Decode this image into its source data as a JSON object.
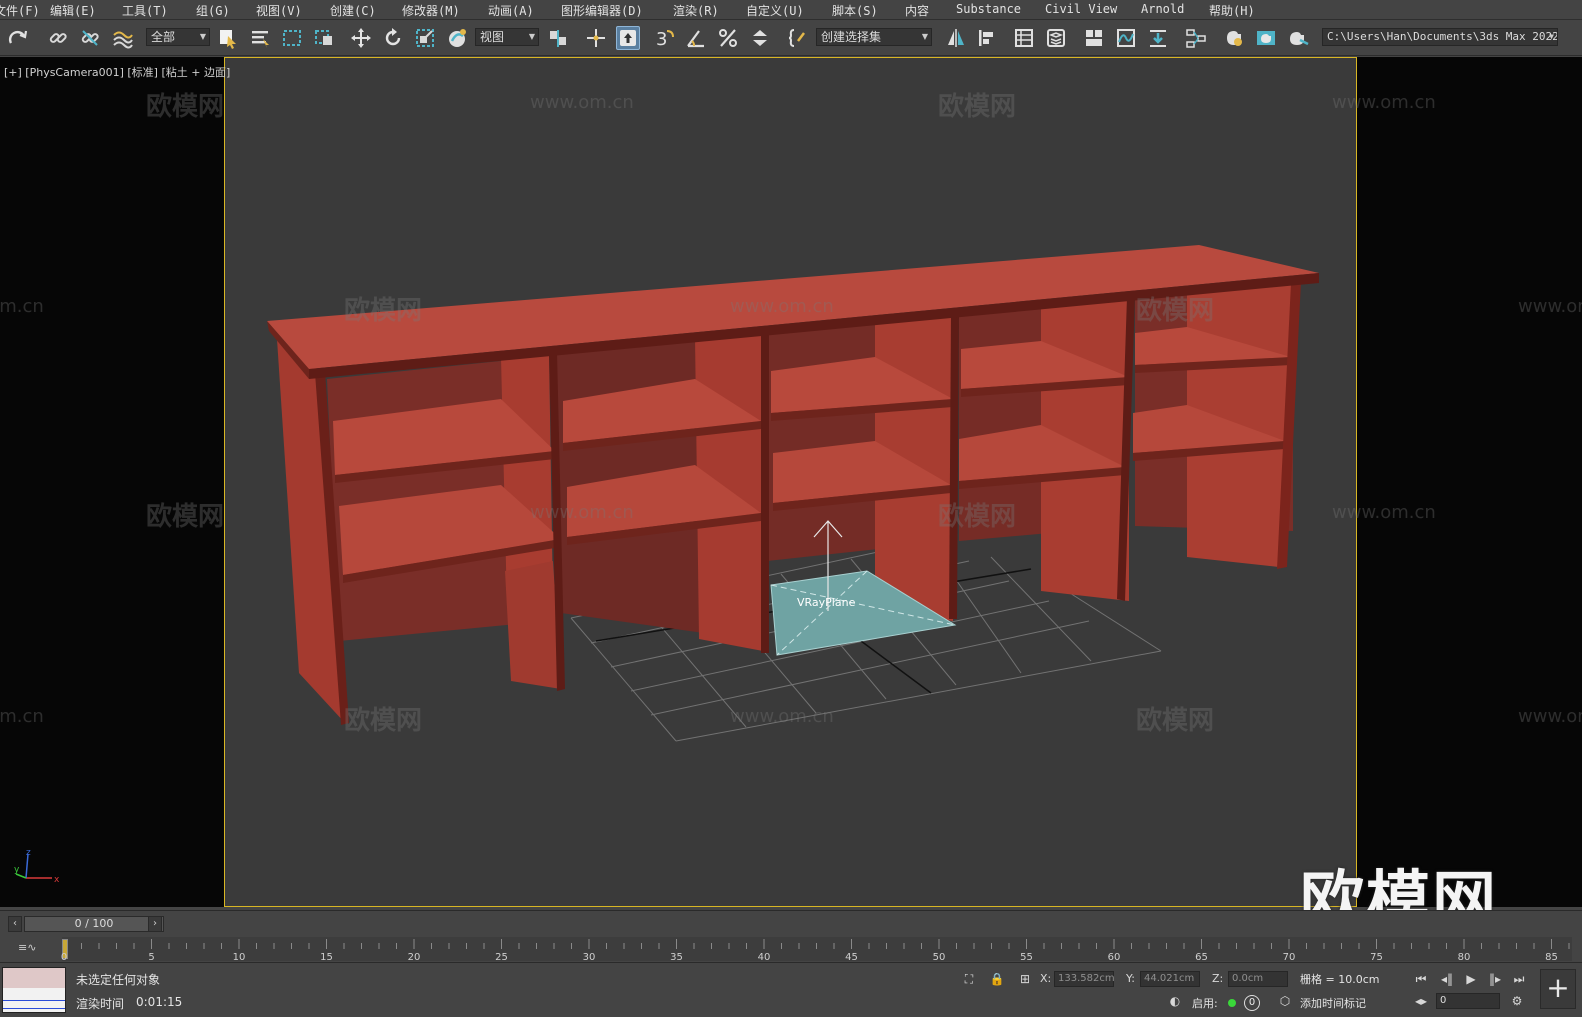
{
  "menu": {
    "items": [
      "文件(F)",
      "编辑(E)",
      "工具(T)",
      "组(G)",
      "视图(V)",
      "创建(C)",
      "修改器(M)",
      "动画(A)",
      "图形编辑器(D)",
      "渲染(R)",
      "自定义(U)",
      "脚本(S)",
      "内容",
      "Substance",
      "Civil View",
      "Arnold",
      "帮助(H)"
    ]
  },
  "toolbar": {
    "selection_filter": "全部",
    "reference_coord": "视图",
    "named_selection": "创建选择集",
    "snap_label": "3",
    "project_path": "C:\\Users\\Han\\Documents\\3ds Max 2022"
  },
  "viewport": {
    "label": "[+] [PhysCamera001] [标准] [粘土 + 边面]",
    "object_label": "VRayPlane",
    "axis_x": "x",
    "axis_y": "y",
    "axis_z": "z"
  },
  "watermarks": {
    "brand": "欧模网",
    "url": "www.om.cn"
  },
  "timeline": {
    "frame_display": "0 / 100",
    "ticks": [
      "0",
      "5",
      "10",
      "15",
      "20",
      "25",
      "30",
      "35",
      "40",
      "45",
      "50",
      "55",
      "60",
      "65",
      "70",
      "75",
      "80",
      "85"
    ]
  },
  "status": {
    "selection": "未选定任何对象",
    "render_time_label": "渲染时间",
    "render_time": "0:01:15",
    "x_label": "X:",
    "x_value": "133.582cm",
    "y_label": "Y:",
    "y_value": "44.021cm",
    "z_label": "Z:",
    "z_value": "0.0cm",
    "grid": "栅格 = 10.0cm",
    "enable_label": "启用:",
    "enable_count": "0",
    "add_time_tag": "添加时间标记",
    "current_frame": "0"
  },
  "colors": {
    "cabinet": "#b84a3e",
    "cabinet_dark": "#7a2018",
    "plane": "#6fa3a3",
    "viewport_border": "#d8b624"
  }
}
